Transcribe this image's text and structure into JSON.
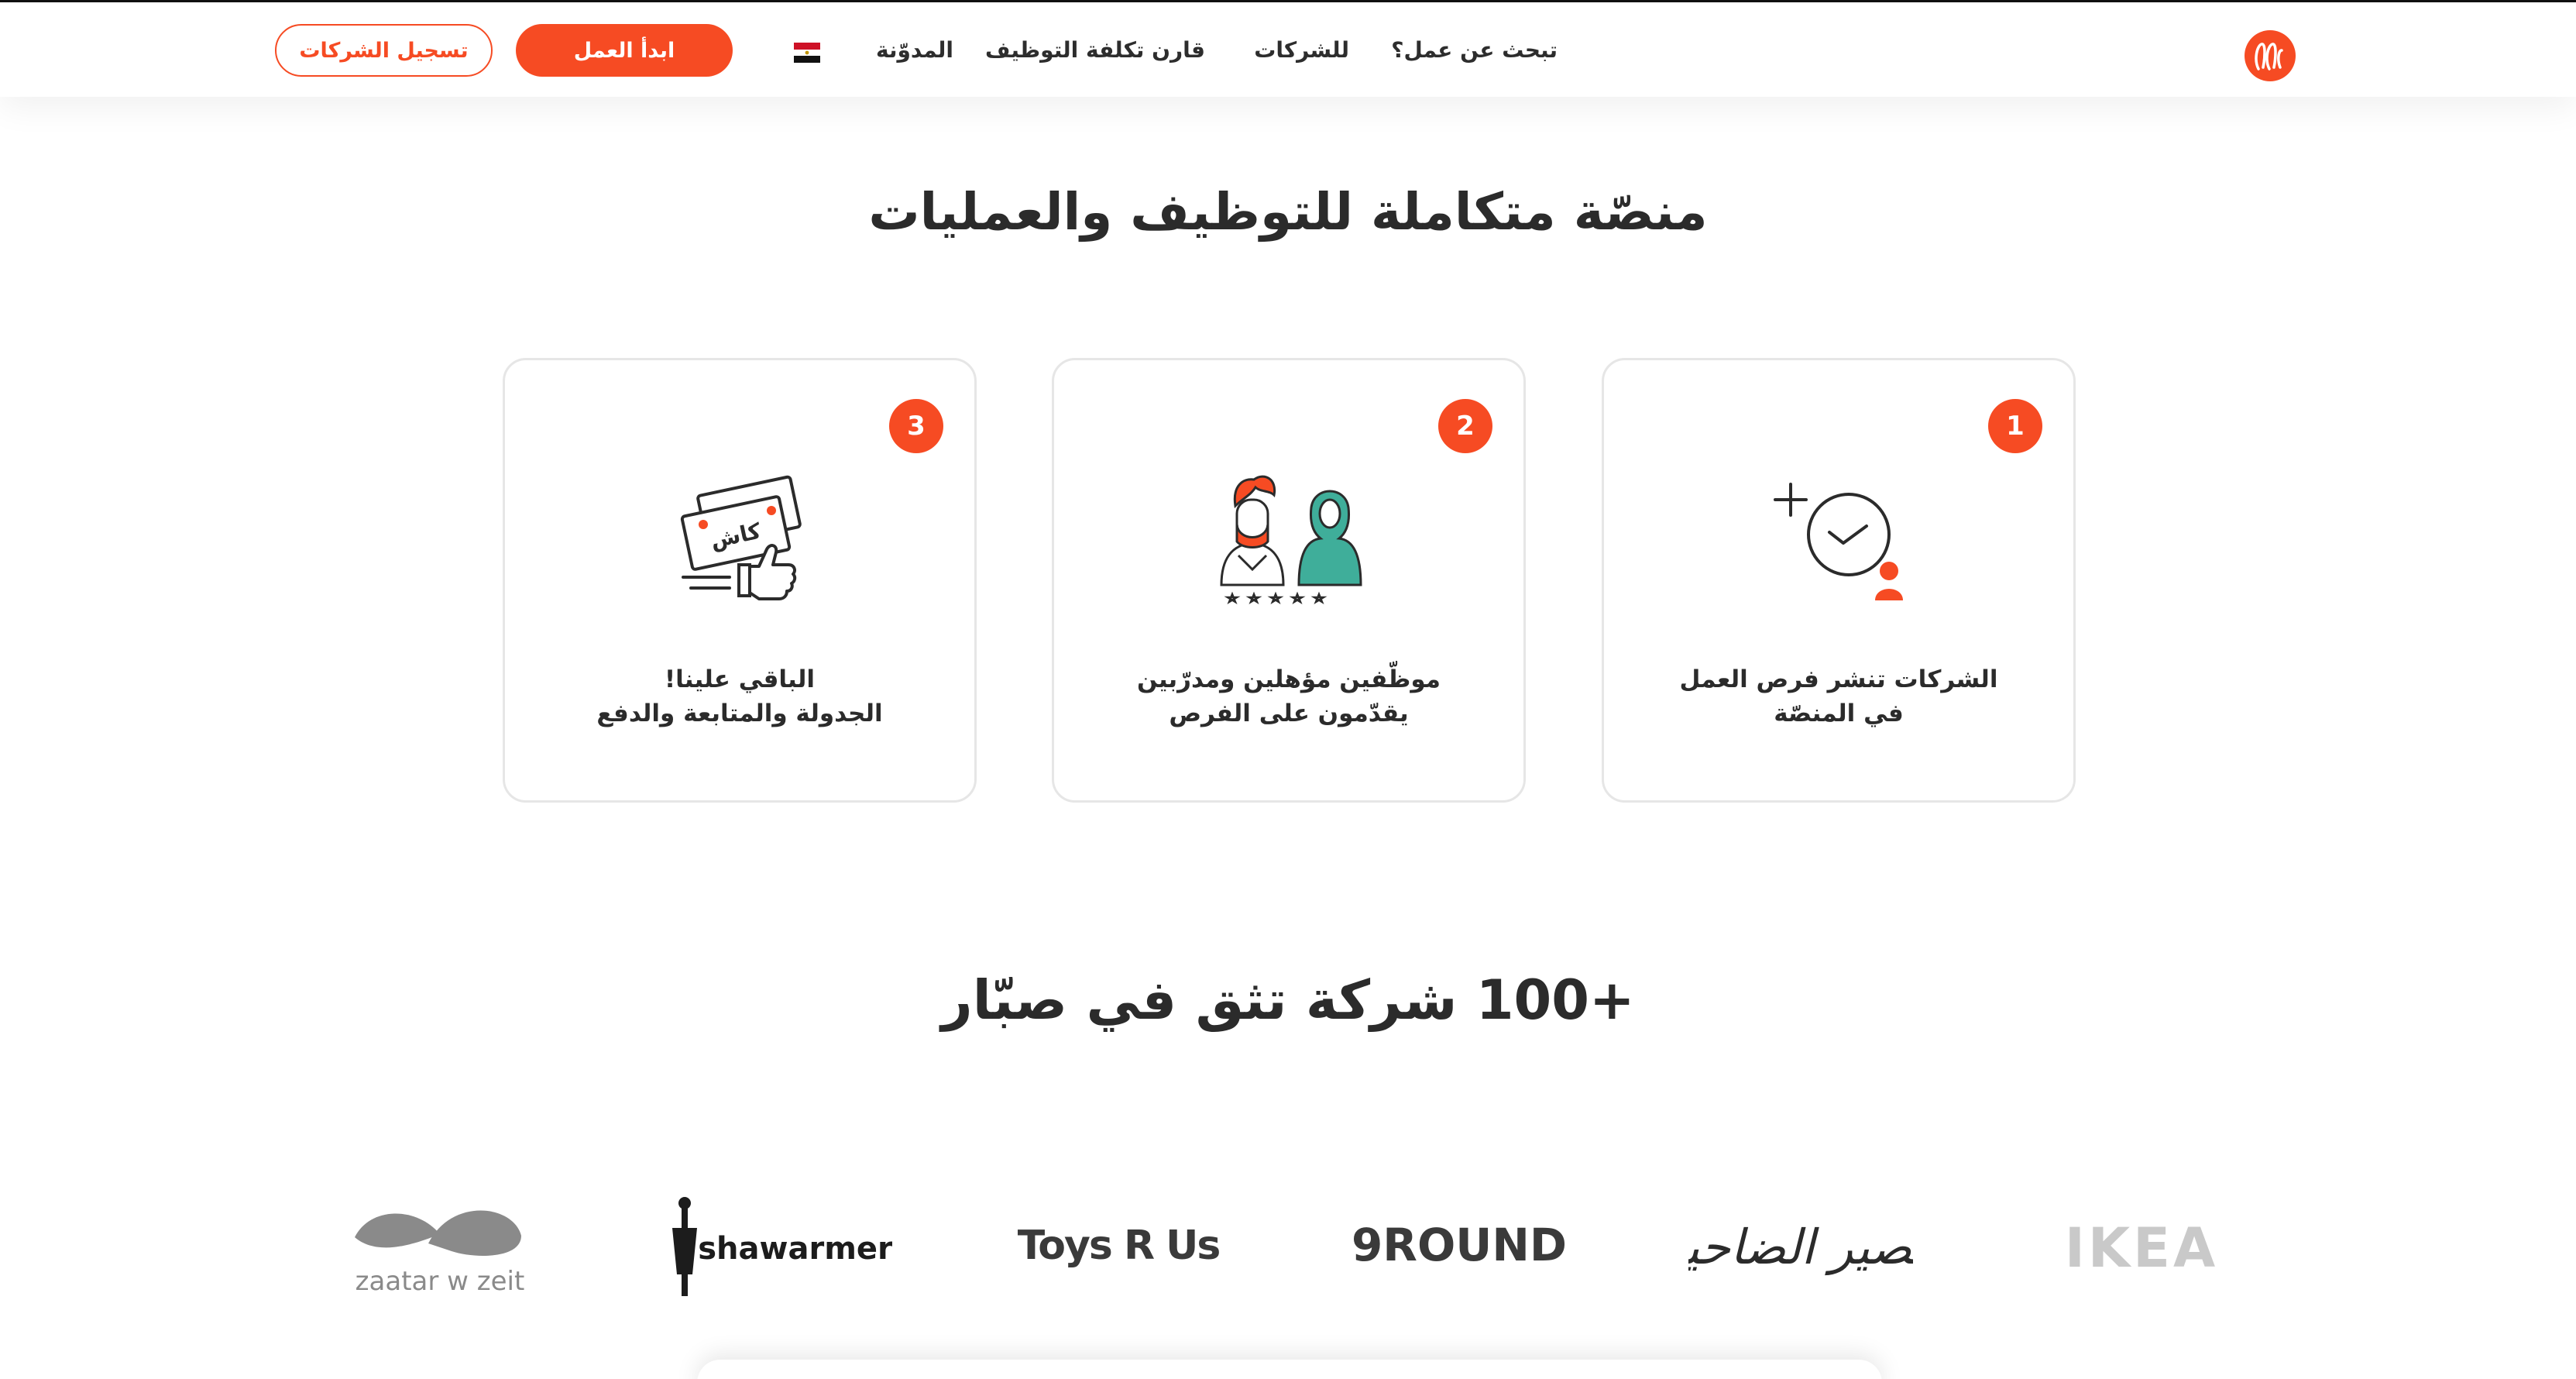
{
  "colors": {
    "brand": "#f64b23",
    "text": "#2b2b2b",
    "teal": "#3fae9a",
    "logo_gray": "#7a7a7a"
  },
  "nav": {
    "jobs": "تبحث عن عمل؟",
    "companies": "للشركات",
    "compare_cost": "قارن تكلفة التوظيف",
    "blog": "المدوّنة",
    "flag_icon": "egypt-flag-icon",
    "start_btn": "ابدأ العمل",
    "register_btn": "تسجيل الشركات"
  },
  "platform": {
    "title": "منصّة متكاملة للتوظيف والعمليات",
    "cards": [
      {
        "number": "1",
        "icon": "clock-check-icon",
        "line1": "الشركات تنشر فرص العمل",
        "line2": "في المنصّة"
      },
      {
        "number": "2",
        "icon": "workers-rating-icon",
        "line1": "موظّفين مؤهلين ومدرّبين",
        "line2": "يقدّمون على الفرص"
      },
      {
        "number": "3",
        "icon": "cash-thumbs-up-icon",
        "cash_label": "كاش",
        "line1": "الباقي علينا!",
        "line2": "الجدولة والمتابعة والدفع"
      }
    ]
  },
  "trust": {
    "title": "+100 شركة تثق في صبّار",
    "logos": {
      "zaatar": "zaatar w zeit",
      "shawarmer": "shawarmer",
      "toys": "Toys R Us",
      "nineround": "9ROUND",
      "asir": "عصير الضاحية",
      "ikea": "IKEA"
    }
  }
}
